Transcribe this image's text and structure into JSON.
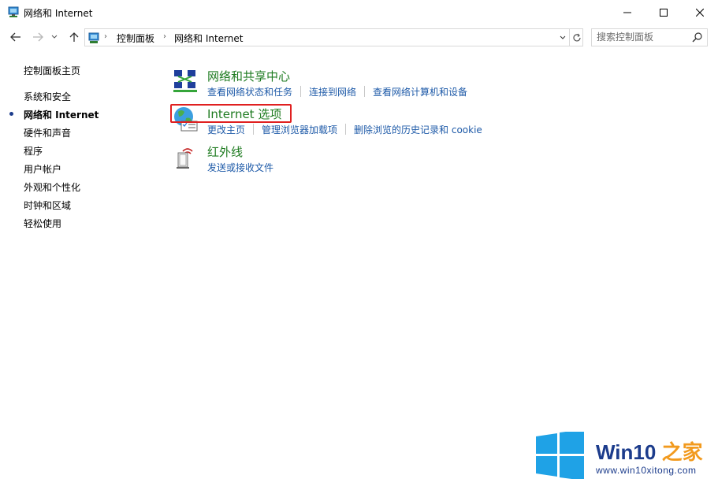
{
  "window": {
    "title": "网络和 Internet"
  },
  "addressbar": {
    "crumbs": [
      "控制面板",
      "网络和 Internet"
    ]
  },
  "search": {
    "placeholder": "搜索控制面板"
  },
  "sidebar": {
    "items": [
      {
        "label": "控制面板主页",
        "active": false
      },
      {
        "label": "系统和安全",
        "active": false
      },
      {
        "label": "网络和 Internet",
        "active": true
      },
      {
        "label": "硬件和声音",
        "active": false
      },
      {
        "label": "程序",
        "active": false
      },
      {
        "label": "用户帐户",
        "active": false
      },
      {
        "label": "外观和个性化",
        "active": false
      },
      {
        "label": "时钟和区域",
        "active": false
      },
      {
        "label": "轻松使用",
        "active": false
      }
    ]
  },
  "categories": [
    {
      "title": "网络和共享中心",
      "icon": "network-sharing-icon",
      "links": [
        "查看网络状态和任务",
        "连接到网络",
        "查看网络计算机和设备"
      ]
    },
    {
      "title": "Internet 选项",
      "icon": "internet-options-icon",
      "links": [
        "更改主页",
        "管理浏览器加载项",
        "删除浏览的历史记录和 cookie"
      ],
      "highlighted": true
    },
    {
      "title": "红外线",
      "icon": "infrared-icon",
      "links": [
        "发送或接收文件"
      ]
    }
  ],
  "watermark": {
    "brand": "Win10",
    "brand_suffix": "之家",
    "url": "www.win10xitong.com"
  },
  "colors": {
    "category_title": "#1e7b20",
    "link": "#1e5aa8",
    "highlight_box": "#e02020",
    "watermark_blue": "#1c3c8c",
    "watermark_accent": "#f29a1e",
    "windows_logo": "#1fa2e6"
  }
}
